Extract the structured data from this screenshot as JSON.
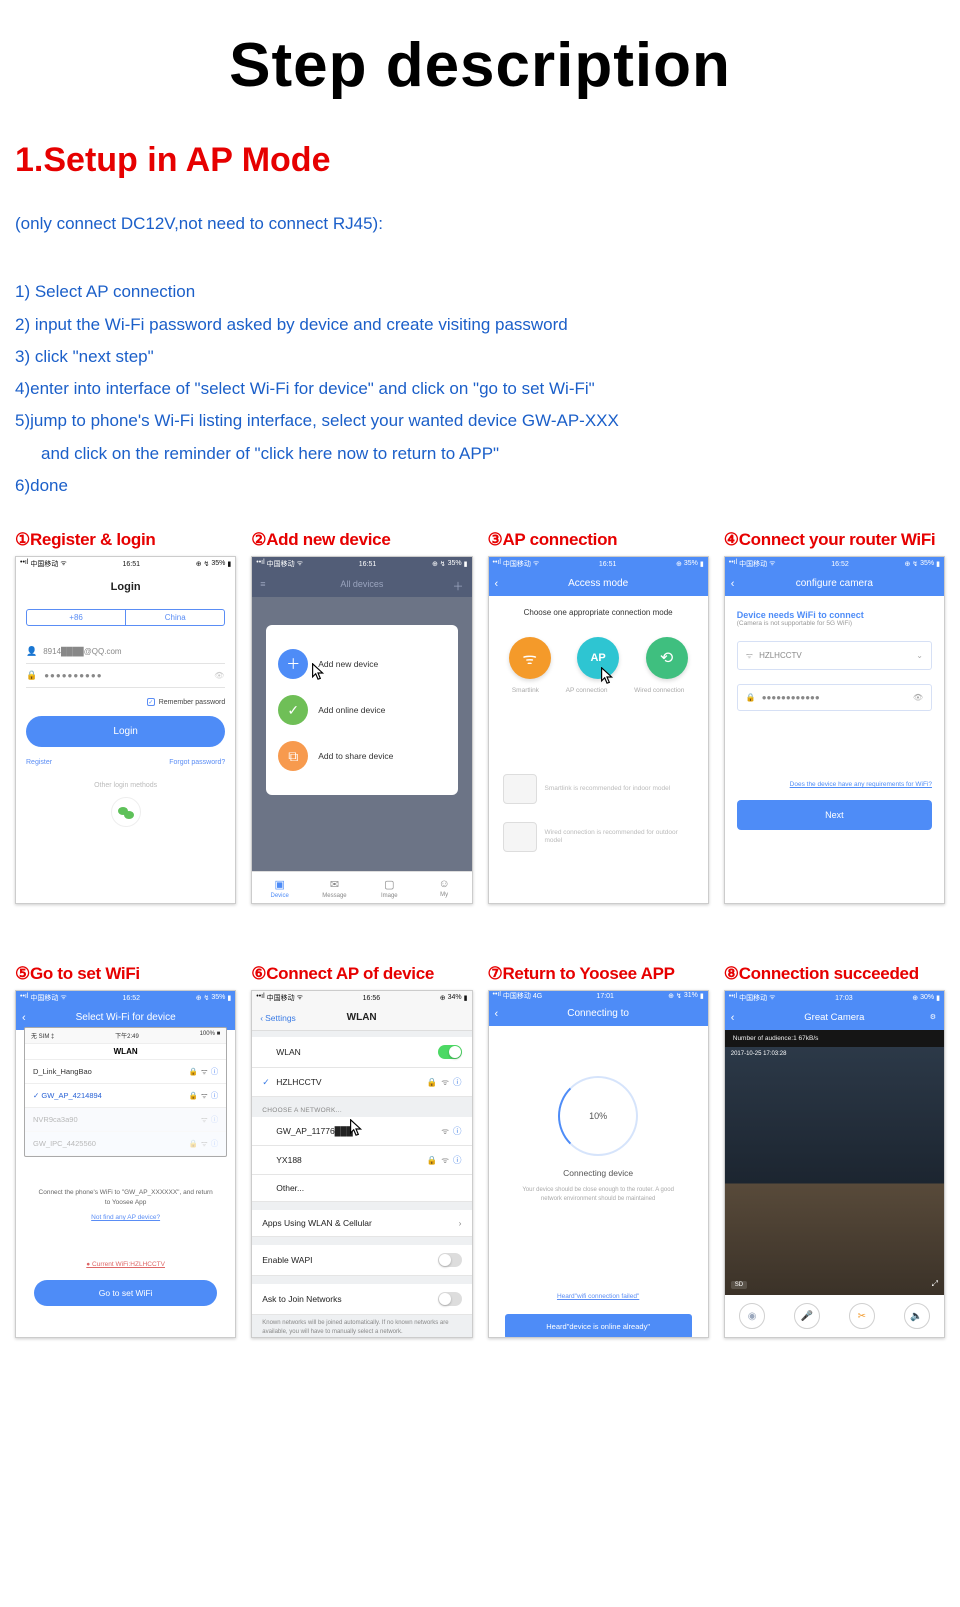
{
  "title": "Step description",
  "section": "1.Setup in AP Mode",
  "note": "(only connect DC12V,not need to connect RJ45):",
  "steps": [
    "1) Select AP connection",
    "2) input the Wi-Fi password asked by device and create visiting password",
    "3) click \"next step\"",
    "4)enter into interface of \"select Wi-Fi for device\" and click on \"go to set Wi-Fi\"",
    "5)jump to phone's Wi-Fi listing interface, select your wanted device GW-AP-XXX",
    "    and click on the reminder of \"click here now to return to APP\"",
    "6)done"
  ],
  "captions": {
    "c1": "①Register & login",
    "c2": "②Add new device",
    "c3": "③AP connection",
    "c4": "④Connect your router WiFi",
    "c5": "⑤Go to set WiFi",
    "c6": "⑥Connect AP of device",
    "c7": "⑦Return to Yoosee APP",
    "c8": "⑧Connection succeeded"
  },
  "statusbar": {
    "carrier": "中国移动",
    "time": "16:51",
    "batt": "35%"
  },
  "s1": {
    "title": "Login",
    "cc": "+86",
    "country": "China",
    "email": "8914████@QQ.com",
    "pass": "●●●●●●●●●●",
    "remember": "Remember password",
    "loginBtn": "Login",
    "register": "Register",
    "forgot": "Forgot password?",
    "other": "Other login methods"
  },
  "s2": {
    "title": "All devices",
    "opt1": "Add new device",
    "opt2": "Add online device",
    "opt3": "Add to share device",
    "nav": [
      "Device",
      "Message",
      "Image",
      "My"
    ]
  },
  "s3": {
    "title": "Access mode",
    "choose": "Choose one appropriate connection mode",
    "l1": "Smartlink",
    "l2": "AP connection",
    "l3": "Wired connection",
    "apText": "AP",
    "rec1": "Smartlink is recommended for indoor model",
    "rec2": "Wired connection is recommended for outdoor model"
  },
  "s4": {
    "title": "configure camera",
    "head": "Device needs WiFi to connect",
    "sub": "(Camera is not supportable for 5G WiFi)",
    "ssid": "HZLHCCTV",
    "pass": "●●●●●●●●●●●●",
    "link": "Does the device have any requirements for WiFi?",
    "btn": "Next"
  },
  "s5": {
    "title": "Select Wi-Fi for device",
    "ibarL": "无 SIM ‡",
    "ibarC": "下午2:49",
    "ibarR": "100% ■",
    "ihead": "WLAN",
    "nets": [
      {
        "n": "D_Link_HangBao",
        "sel": false,
        "faded": false
      },
      {
        "n": "GW_AP_4214894",
        "sel": true,
        "faded": false
      },
      {
        "n": "NVR9ca3a90",
        "sel": false,
        "faded": true
      },
      {
        "n": "GW_IPC_4425560",
        "sel": false,
        "faded": true
      }
    ],
    "msg": "Connect the phone's WiFi to \"GW_AP_XXXXXX\", and return to Yoosee  App",
    "link": "Not find any AP device?",
    "current": "Current WiFi:HZLHCCTV",
    "btn": "Go to set WiFi"
  },
  "s6": {
    "back": "Settings",
    "title": "WLAN",
    "time": "16:56",
    "batt": "34%",
    "wlan": "WLAN",
    "ssid": "HZLHCCTV",
    "sec": "CHOOSE A NETWORK...",
    "nets": [
      "GW_AP_11776███",
      "YX188",
      "Other..."
    ],
    "apps": "Apps Using WLAN & Cellular",
    "wapi": "Enable WAPI",
    "join": "Ask to Join Networks",
    "desc": "Known networks will be joined automatically. If no known networks are available, you will have to manually select a network."
  },
  "s7": {
    "carrier": "中国移动 4G",
    "time": "17:01",
    "batt": "31%",
    "title": "Connecting to",
    "pct": "10%",
    "t1": "Connecting device",
    "t2": "Your device should be close enough to the router. A good network environment should be maintained",
    "toast1": "Heard\"wifi connection failed\"",
    "toast2": "Heard\"device is online already\""
  },
  "s8": {
    "time": "17:03",
    "batt": "30%",
    "title": "Great Camera",
    "info": "Number of audience:1   67kB/s",
    "ts": "2017-10-25  17:03:28",
    "sd": "SD"
  }
}
